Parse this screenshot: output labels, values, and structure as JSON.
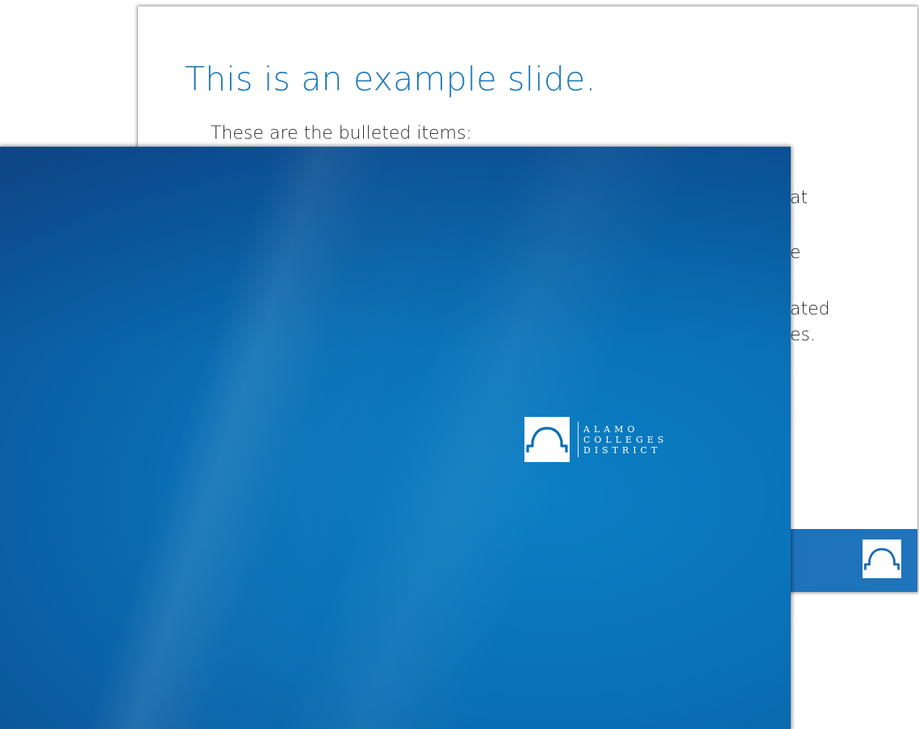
{
  "back_slide": {
    "title": "This is an example slide.",
    "bullet_intro": "These are the bulleted items:",
    "visible_fragments": [
      "at",
      "e",
      "ated",
      "es."
    ]
  },
  "front_slide": {
    "logo": {
      "line1": "ALAMO",
      "line2": "COLLEGES",
      "line3": "DISTRICT"
    }
  },
  "colors": {
    "title_blue": "#1a78b8",
    "slide_blue": "#0a6fb5",
    "footer_blue": "#1a6bb3"
  },
  "icons": {
    "logo_mark": "arch-icon",
    "footer_mark": "arch-icon"
  }
}
